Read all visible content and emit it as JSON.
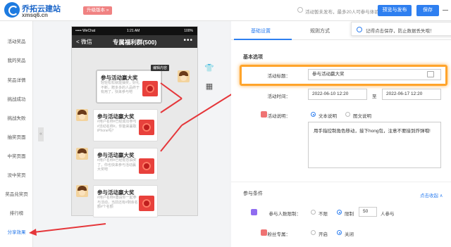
{
  "app": {
    "brand_name": "乔拓云建站",
    "brand_url": "xmsq6.cn",
    "upgrade_label": "升级版本 »",
    "notice_text": "活动暂未发布，最多20人可参与体验",
    "preview_publish_label": "预览与发布",
    "save_label": "保存"
  },
  "sidebar": {
    "items": [
      {
        "label": "活动奖品"
      },
      {
        "label": "我的奖品"
      },
      {
        "label": "奖品详情"
      },
      {
        "label": "挑战成功"
      },
      {
        "label": "挑战失败"
      },
      {
        "label": "抽奖页面"
      },
      {
        "label": "中奖页面"
      },
      {
        "label": "没中奖页"
      },
      {
        "label": "奖品兑奖页"
      },
      {
        "label": "排行榜"
      },
      {
        "label": "分享效果"
      }
    ],
    "active_index": 10
  },
  "phone": {
    "status_carrier": "••••• WeChat",
    "status_time": "1:21 AM",
    "status_battery": "100%",
    "back_label": "< 微信",
    "chat_title": "专属福利群(500)",
    "more_label": "•••",
    "tooltip": "编辑内容",
    "messages": [
      {
        "title": "参与活动赢大奖",
        "desc": "轻轻松松就能抽奖，好礼不断，赠多多的人品终于有用了，快来参与吧"
      },
      {
        "title": "参与活动赢大奖",
        "desc": "#用户名称#已经成功参与#活动名称#，你能来赢取iPhone吗？"
      },
      {
        "title": "参与活动赢大奖",
        "desc": "#用户名称#已经帮您抽奖了，你也快来参与活动赢大奖吧"
      },
      {
        "title": "参与活动赢大奖",
        "desc": "#用户名称#邀请你一起参与活动，当前还有#剩余名额#个名额"
      }
    ]
  },
  "panel": {
    "tabs": [
      {
        "label": "基础设置"
      },
      {
        "label": "规则方式"
      }
    ],
    "toast": "记得点击保存，防止数据丢失哦！",
    "basic_section": "基本选项",
    "title_label": "活动标题：",
    "title_value": "参与活动赢大奖",
    "time_label": "活动时间：",
    "start_time": "2022-06-10 12:20",
    "time_sep": "至",
    "end_time": "2022-06-17 12:20",
    "desc_label": "活动说明：",
    "desc_opt_text": "文本说明",
    "desc_opt_image": "图文说明",
    "desc_value": "用手指控制角色移动，接下hong包，注意不要接到炸弹哦!",
    "cond_section": "参与条件",
    "collapse_label": "点击收起 ∧",
    "limit_label": "参与人数限制：",
    "limit_opt_no": "不限",
    "limit_opt_yes": "限制",
    "limit_value": "50",
    "limit_unit": "人参与",
    "fans_label": "粉丝专属：",
    "fans_on": "开启",
    "fans_off": "关闭"
  }
}
